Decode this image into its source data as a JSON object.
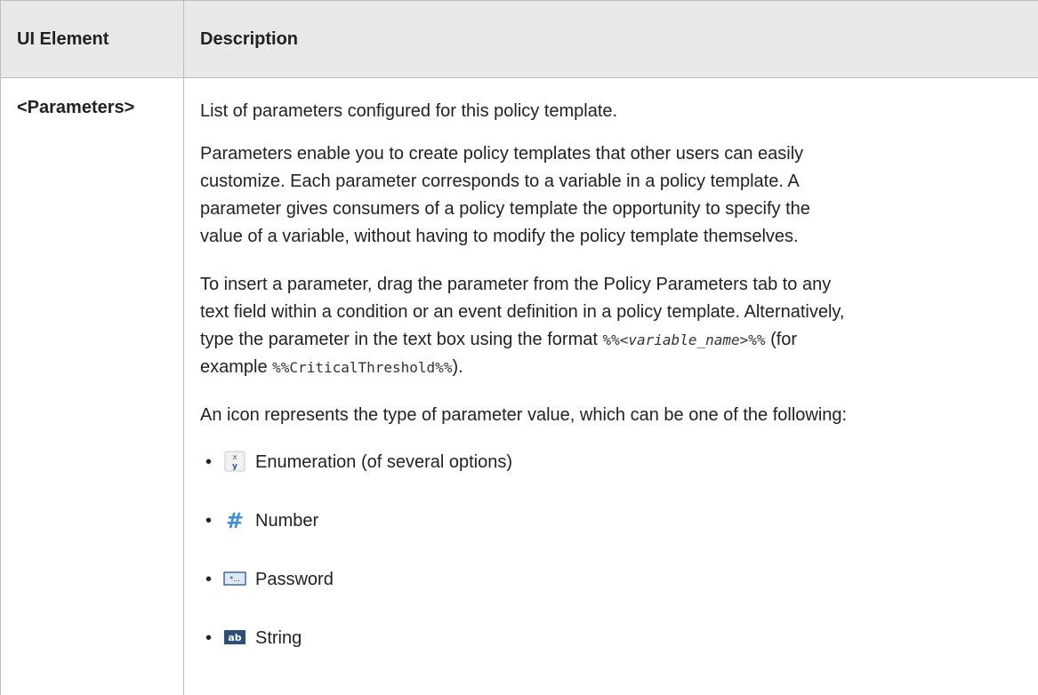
{
  "table": {
    "header_element": "UI Element",
    "header_description": "Description",
    "row": {
      "element": "<Parameters>",
      "p1": "List of parameters configured for this policy template.",
      "p2_line1": "Parameters enable you to create policy templates that other users can easily",
      "p2_line2": "customize. Each parameter corresponds to a variable in a policy template. A",
      "p2_line3": "parameter gives consumers of a policy template the opportunity to specify the",
      "p2_line4": "value of a variable, without having to modify the policy template themselves.",
      "p3_line1": "To insert a parameter, drag the parameter from the Policy Parameters tab to any",
      "p3_line2": "text field within a condition or an event definition in a policy template. Alternatively,",
      "p3_line3_a": "type the parameter in the text box using the format ",
      "p3_code_pre": "%%<",
      "p3_code_var": "variable_name",
      "p3_code_post": ">%%",
      "p3_line3_b": " (for",
      "p3_line4_a": "example ",
      "p3_code_example": "%%CriticalThreshold%%",
      "p3_line4_b": ").",
      "p4": "An icon represents the type of parameter value, which can be one of the following:",
      "types": [
        {
          "label": "Enumeration (of several options)",
          "icon": "enumeration-icon",
          "glyph_x": "x",
          "glyph_y": "y"
        },
        {
          "label": "Number",
          "icon": "number-icon",
          "glyph": "#"
        },
        {
          "label": "Password",
          "icon": "password-icon",
          "glyph": "*..."
        },
        {
          "label": "String",
          "icon": "string-icon",
          "glyph": "ab"
        }
      ],
      "bullet": "•"
    }
  },
  "colors": {
    "header_bg": "#e8e8e8",
    "border": "#bdbdbd",
    "text": "#222222",
    "number_icon": "#3a8fd6",
    "string_icon": "#2b4f7a"
  }
}
